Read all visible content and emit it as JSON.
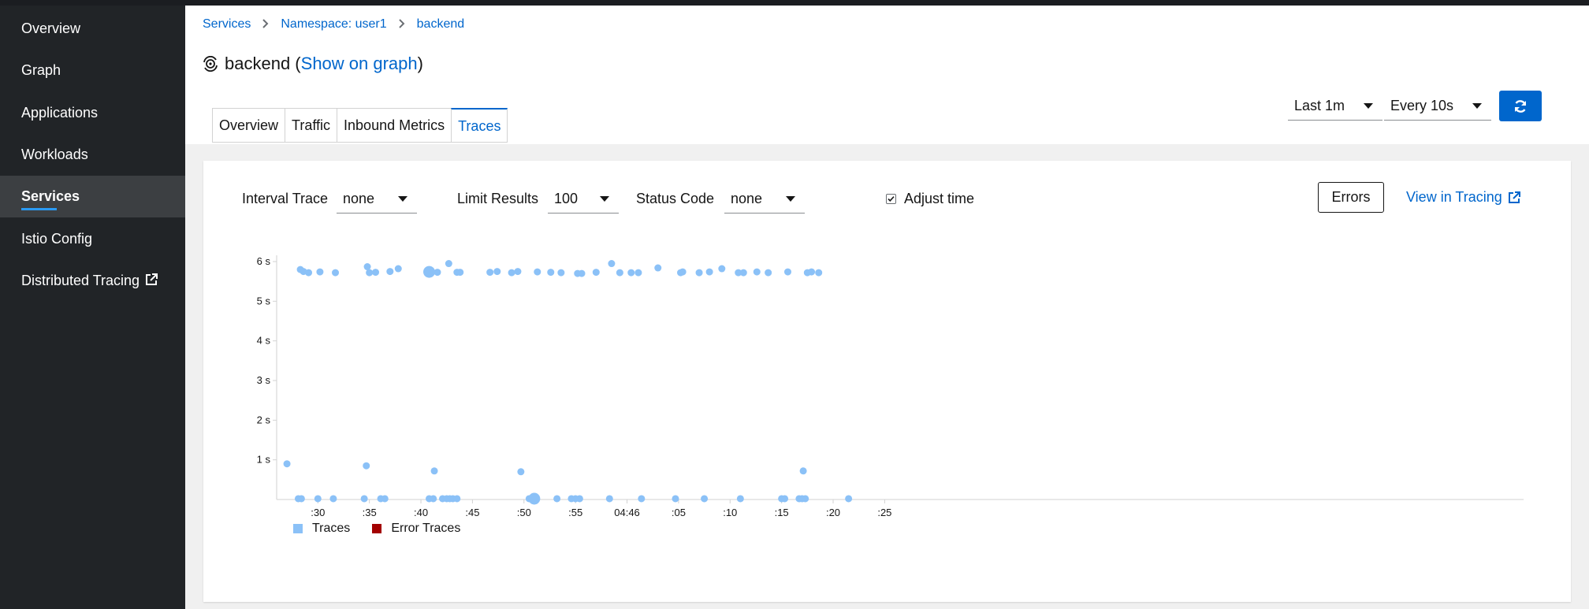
{
  "sidebar": {
    "items": [
      {
        "label": "Overview",
        "active": false
      },
      {
        "label": "Graph",
        "active": false
      },
      {
        "label": "Applications",
        "active": false
      },
      {
        "label": "Workloads",
        "active": false
      },
      {
        "label": "Services",
        "active": true
      },
      {
        "label": "Istio Config",
        "active": false
      },
      {
        "label": "Distributed Tracing",
        "active": false,
        "external": true
      }
    ]
  },
  "breadcrumb": {
    "items": [
      "Services",
      "Namespace: user1",
      "backend"
    ]
  },
  "title": {
    "name": "backend",
    "open_paren": " (",
    "link": "Show on graph",
    "close_paren": ")"
  },
  "tabs": [
    {
      "label": "Overview",
      "active": false
    },
    {
      "label": "Traffic",
      "active": false
    },
    {
      "label": "Inbound Metrics",
      "active": false
    },
    {
      "label": "Traces",
      "active": true
    }
  ],
  "toolbar": {
    "duration": "Last 1m",
    "refresh_interval": "Every 10s"
  },
  "filters": {
    "interval_trace_label": "Interval Trace",
    "interval_trace_value": "none",
    "limit_label": "Limit Results",
    "limit_value": "100",
    "status_label": "Status Code",
    "status_value": "none",
    "adjust_time_label": "Adjust time",
    "adjust_time_checked": true,
    "errors_button": "Errors",
    "view_in_tracing": "View in Tracing"
  },
  "colors": {
    "accent": "#0066cc",
    "trace": "#8bc1f7",
    "error_trace": "#a30000"
  },
  "chart_data": {
    "type": "scatter",
    "x_unit": "time (minute:second, 04:45:27 → 04:47:26)",
    "y_unit": "seconds",
    "xlim": [
      "04:45:26",
      "04:47:27"
    ],
    "ylim": [
      0,
      6
    ],
    "y_ticks": [
      1,
      2,
      3,
      4,
      5,
      6
    ],
    "y_tick_labels": [
      "1 s",
      "2 s",
      "3 s",
      "4 s",
      "5 s",
      "6 s"
    ],
    "x_tick_labels": [
      ":30",
      ":35",
      ":40",
      ":45",
      ":50",
      ":55",
      "04:46",
      ":05",
      ":10",
      ":15",
      ":20",
      ":25"
    ],
    "x_ticks": [
      "04:45:30",
      "04:45:35",
      "04:45:40",
      "04:45:45",
      "04:45:50",
      "04:45:55",
      "04:46:00",
      "04:46:05",
      "04:46:10",
      "04:46:15",
      "04:46:20",
      "04:46:25"
    ],
    "grid": false,
    "legend": "bottom-left",
    "legend_entries": [
      "Traces",
      "Error Traces"
    ],
    "series": [
      {
        "name": "Traces",
        "points": [
          [
            "04:45:27.0",
            0.9,
            1
          ],
          [
            "04:45:28.1",
            0.02,
            1
          ],
          [
            "04:45:28.4",
            0.02,
            1
          ],
          [
            "04:45:30.0",
            0.02,
            1
          ],
          [
            "04:45:31.5",
            0.02,
            1
          ],
          [
            "04:45:34.5",
            0.02,
            1
          ],
          [
            "04:45:34.7",
            0.85,
            1
          ],
          [
            "04:45:36.1",
            0.02,
            1
          ],
          [
            "04:45:36.5",
            0.02,
            1
          ],
          [
            "04:45:40.8",
            0.02,
            1
          ],
          [
            "04:45:41.2",
            0.02,
            1
          ],
          [
            "04:45:41.3",
            0.72,
            1
          ],
          [
            "04:45:42.1",
            0.02,
            1
          ],
          [
            "04:45:42.5",
            0.02,
            1
          ],
          [
            "04:45:42.8",
            0.02,
            1
          ],
          [
            "04:45:43.1",
            0.02,
            1
          ],
          [
            "04:45:43.5",
            0.02,
            1
          ],
          [
            "04:45:49.7",
            0.7,
            1
          ],
          [
            "04:45:50.5",
            0.02,
            1
          ],
          [
            "04:45:51.0",
            0.02,
            2
          ],
          [
            "04:45:53.2",
            0.02,
            1
          ],
          [
            "04:45:54.6",
            0.02,
            1
          ],
          [
            "04:45:55.0",
            0.02,
            1
          ],
          [
            "04:45:55.4",
            0.02,
            1
          ],
          [
            "04:45:58.3",
            0.02,
            1
          ],
          [
            "04:46:01.4",
            0.02,
            1
          ],
          [
            "04:46:04.7",
            0.02,
            1
          ],
          [
            "04:46:07.5",
            0.02,
            1
          ],
          [
            "04:46:11.0",
            0.02,
            1
          ],
          [
            "04:46:15.0",
            0.02,
            1
          ],
          [
            "04:46:15.3",
            0.02,
            1
          ],
          [
            "04:46:16.7",
            0.02,
            1
          ],
          [
            "04:46:17.0",
            0.02,
            1
          ],
          [
            "04:46:17.1",
            0.72,
            1
          ],
          [
            "04:46:17.3",
            0.02,
            1
          ],
          [
            "04:46:21.5",
            0.02,
            1
          ],
          [
            "04:45:28.3",
            5.8,
            1
          ],
          [
            "04:45:28.6",
            5.75,
            1
          ],
          [
            "04:45:29.1",
            5.72,
            1
          ],
          [
            "04:45:30.2",
            5.74,
            1
          ],
          [
            "04:45:31.7",
            5.72,
            1
          ],
          [
            "04:45:34.8",
            5.87,
            1
          ],
          [
            "04:45:35.0",
            5.72,
            1
          ],
          [
            "04:45:35.6",
            5.73,
            1
          ],
          [
            "04:45:37.0",
            5.75,
            1
          ],
          [
            "04:45:37.8",
            5.82,
            1
          ],
          [
            "04:45:40.8",
            5.74,
            2
          ],
          [
            "04:45:41.6",
            5.73,
            1
          ],
          [
            "04:45:42.7",
            5.95,
            1
          ],
          [
            "04:45:43.5",
            5.73,
            1
          ],
          [
            "04:45:43.8",
            5.73,
            1
          ],
          [
            "04:45:46.7",
            5.73,
            1
          ],
          [
            "04:45:47.4",
            5.75,
            1
          ],
          [
            "04:45:48.8",
            5.72,
            1
          ],
          [
            "04:45:49.4",
            5.75,
            1
          ],
          [
            "04:45:51.3",
            5.74,
            1
          ],
          [
            "04:45:52.6",
            5.73,
            1
          ],
          [
            "04:45:53.6",
            5.72,
            1
          ],
          [
            "04:45:55.2",
            5.7,
            1
          ],
          [
            "04:45:55.6",
            5.7,
            1
          ],
          [
            "04:45:57.0",
            5.73,
            1
          ],
          [
            "04:45:58.5",
            5.95,
            1
          ],
          [
            "04:45:59.3",
            5.72,
            1
          ],
          [
            "04:46:00.4",
            5.72,
            1
          ],
          [
            "04:46:01.1",
            5.72,
            1
          ],
          [
            "04:46:03.0",
            5.84,
            1
          ],
          [
            "04:46:05.2",
            5.72,
            1
          ],
          [
            "04:46:05.4",
            5.74,
            1
          ],
          [
            "04:46:07.0",
            5.72,
            1
          ],
          [
            "04:46:08.0",
            5.74,
            1
          ],
          [
            "04:46:09.2",
            5.82,
            1
          ],
          [
            "04:46:10.8",
            5.72,
            1
          ],
          [
            "04:46:11.3",
            5.72,
            1
          ],
          [
            "04:46:12.6",
            5.74,
            1
          ],
          [
            "04:46:13.7",
            5.72,
            1
          ],
          [
            "04:46:15.6",
            5.74,
            1
          ],
          [
            "04:46:17.5",
            5.72,
            1
          ],
          [
            "04:46:17.9",
            5.74,
            1
          ],
          [
            "04:46:18.6",
            5.72,
            1
          ]
        ]
      },
      {
        "name": "Error Traces",
        "points": []
      }
    ]
  }
}
